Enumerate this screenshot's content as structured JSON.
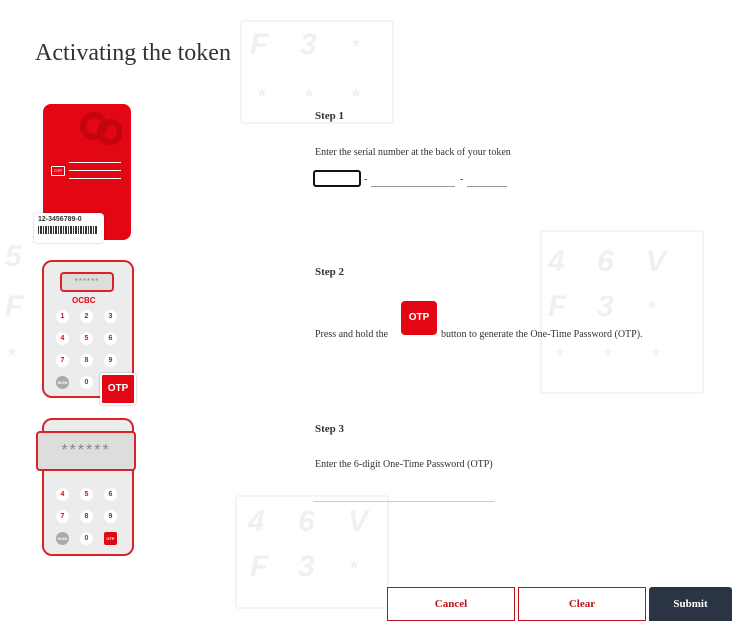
{
  "page": {
    "title": "Activating the token"
  },
  "illustration": {
    "serial_sample": "12-3456789-0",
    "brand": "OCBC",
    "screen_masked": "******",
    "otp_key": "OTP",
    "otp_key_small": "OTP",
    "otp_card_mini": "OTP",
    "keypad": [
      "1",
      "2",
      "3",
      "4",
      "5",
      "6",
      "7",
      "8",
      "9",
      "0"
    ],
    "keypad_special": "SIGN"
  },
  "steps": [
    {
      "label": "Step 1",
      "text": "Enter the serial number at the back of your token",
      "separator": "-"
    },
    {
      "label": "Step 2",
      "text_before": "Press and hold the",
      "button_label": "OTP",
      "text_after": "button to generate the One-Time Password (OTP)."
    },
    {
      "label": "Step 3",
      "text": "Enter the 6-digit One-Time Password (OTP)"
    }
  ],
  "form": {
    "serial_part1": "",
    "serial_part2": "",
    "serial_part3": "",
    "otp_value": ""
  },
  "buttons": {
    "cancel": "Cancel",
    "clear": "Clear",
    "submit": "Submit"
  },
  "colors": {
    "accent": "#e30613",
    "outline": "#b8121a",
    "submit_bg": "#2b3443"
  },
  "background_pattern": {
    "chars": [
      "F",
      "3",
      "4",
      "6",
      "V",
      "F",
      "3",
      "4",
      "6",
      "V",
      "F",
      "3",
      "5",
      "F"
    ],
    "star": "*"
  }
}
